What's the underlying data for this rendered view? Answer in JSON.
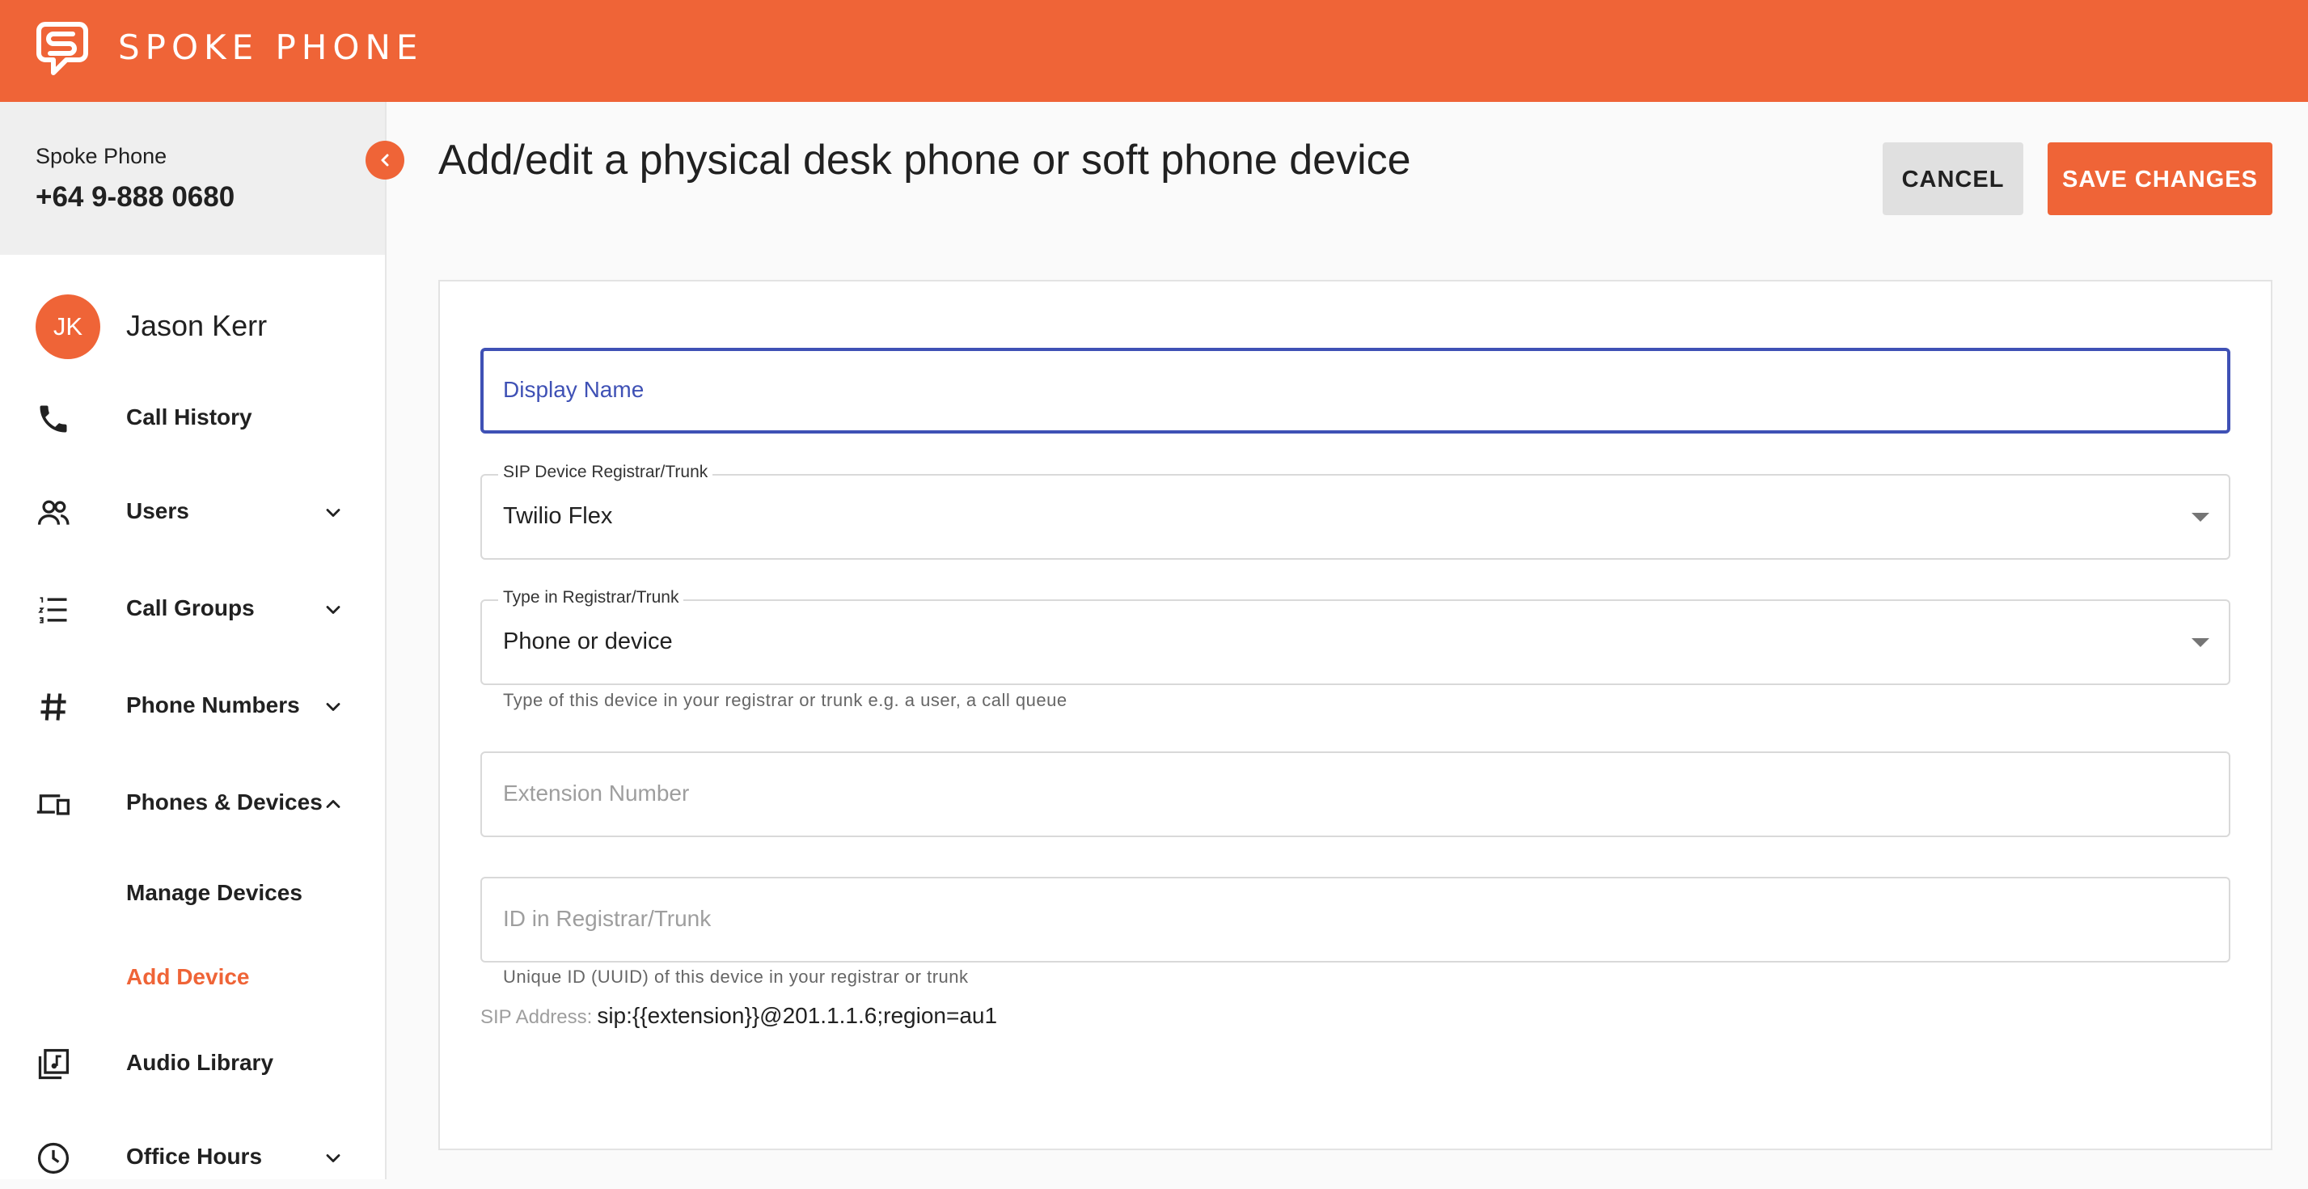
{
  "header": {
    "brand": "SPOKE PHONE",
    "logo_icon": "speech-bubble-s-icon",
    "background": "#ef6437"
  },
  "account": {
    "name": "Spoke Phone",
    "phone": "+64 9-888 0680"
  },
  "user": {
    "initials": "JK",
    "name": "Jason Kerr"
  },
  "sidebar": {
    "items": [
      {
        "label": "Call History",
        "icon": "phone-icon"
      },
      {
        "label": "Users",
        "icon": "users-icon",
        "chevron": "down"
      },
      {
        "label": "Call Groups",
        "icon": "numbered-list-icon",
        "chevron": "down"
      },
      {
        "label": "Phone Numbers",
        "icon": "hash-icon",
        "chevron": "down"
      },
      {
        "label": "Phones & Devices",
        "icon": "devices-icon",
        "chevron": "up"
      },
      {
        "label": "Audio Library",
        "icon": "music-library-icon"
      },
      {
        "label": "Office Hours",
        "icon": "clock-icon",
        "chevron": "down"
      }
    ],
    "subitems": [
      {
        "label": "Manage Devices",
        "active": false
      },
      {
        "label": "Add Device",
        "active": true
      }
    ]
  },
  "page": {
    "title": "Add/edit a physical desk phone or soft phone device",
    "cancel_label": "CANCEL",
    "save_label": "SAVE CHANGES"
  },
  "form": {
    "display_name": {
      "placeholder": "Display Name",
      "value": ""
    },
    "registrar": {
      "label": "SIP Device Registrar/Trunk",
      "value": "Twilio Flex"
    },
    "type": {
      "label": "Type in Registrar/Trunk",
      "value": "Phone or device",
      "helper": "Type of this device in your registrar or trunk e.g. a user, a call queue"
    },
    "extension": {
      "placeholder": "Extension Number",
      "value": ""
    },
    "registrar_id": {
      "placeholder": "ID in Registrar/Trunk",
      "value": "",
      "helper": "Unique ID (UUID) of this device in your registrar or trunk"
    },
    "sip_address": {
      "label": "SIP Address:",
      "value": "sip:{{extension}}@201.1.1.6;region=au1"
    }
  },
  "colors": {
    "accent": "#ef6437",
    "focus": "#3f51b5"
  }
}
